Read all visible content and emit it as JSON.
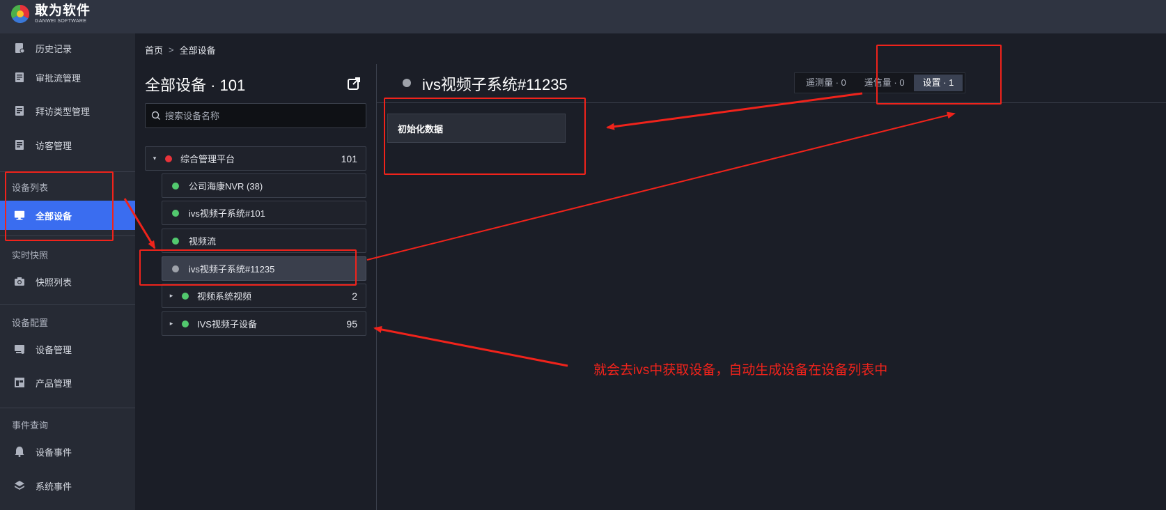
{
  "brand": {
    "name_cn": "敢为软件",
    "name_en": "GANWEI SOFTWARE"
  },
  "sidebar": {
    "items": [
      {
        "id": "history",
        "label": "历史记录",
        "icon": "history-icon"
      },
      {
        "id": "approval",
        "label": "审批流管理",
        "icon": "document-icon"
      },
      {
        "id": "visit-type",
        "label": "拜访类型管理",
        "icon": "document-icon"
      },
      {
        "id": "visitor",
        "label": "访客管理",
        "icon": "document-icon"
      }
    ],
    "groups": {
      "device_list": "设备列表",
      "realtime": "实时快照",
      "device_config": "设备配置",
      "event_query": "事件查询"
    },
    "all_devices": "全部设备",
    "snapshot_list": "快照列表",
    "device_manage": "设备管理",
    "product_manage": "产品管理",
    "device_events": "设备事件",
    "system_events": "系统事件"
  },
  "breadcrumb": {
    "home": "首页",
    "sep": ">",
    "current": "全部设备"
  },
  "tree_panel": {
    "title": "全部设备 · 101",
    "search_placeholder": "搜索设备名称",
    "rows": [
      {
        "label": "综合管理平台",
        "count": "101",
        "status": "#e8333a",
        "caret": "▾"
      },
      {
        "label": "公司海康NVR (38)",
        "count": "",
        "status": "#52c96e",
        "caret": ""
      },
      {
        "label": "ivs视频子系统#101",
        "count": "",
        "status": "#52c96e",
        "caret": ""
      },
      {
        "label": "视频流",
        "count": "",
        "status": "#52c96e",
        "caret": ""
      },
      {
        "label": "ivs视频子系统#11235",
        "count": "",
        "status": "#9ea2aa",
        "caret": ""
      },
      {
        "label": "视频系统视频",
        "count": "2",
        "status": "#52c96e",
        "caret": "▸"
      },
      {
        "label": "IVS视频子设备",
        "count": "95",
        "status": "#52c96e",
        "caret": "▸"
      }
    ]
  },
  "detail": {
    "title": "ivs视频子系统#11235",
    "tabs": [
      {
        "label": "遥测量 · 0"
      },
      {
        "label": "遥信量 · 0"
      },
      {
        "label": "设置 · 1"
      }
    ],
    "init_button": "初始化数据"
  },
  "annotation": {
    "note": "就会去ivs中获取设备，自动生成设备在设备列表中",
    "color": "#f0231b"
  },
  "colors": {
    "accent": "#3a6df0",
    "online": "#52c96e",
    "alarm": "#e8333a",
    "offline": "#9ea2aa"
  }
}
